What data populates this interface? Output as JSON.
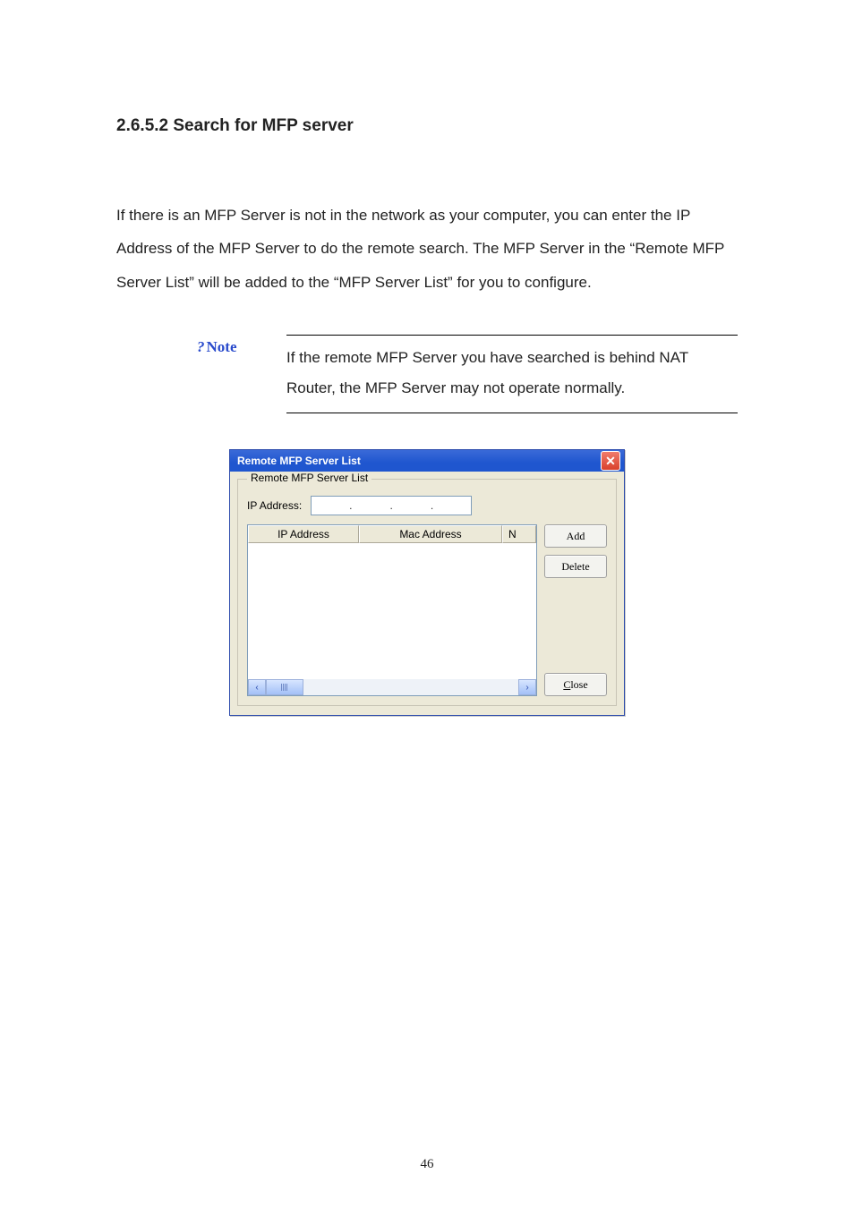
{
  "heading": "2.6.5.2 Search for MFP server",
  "paragraph": "If there is an MFP Server is not in the network as your computer, you can enter the IP Address of the MFP Server to do the remote search. The MFP Server in the “Remote MFP Server List” will be added to the “MFP Server List” for you to configure.",
  "note": {
    "label": "Note",
    "body": "If the remote MFP Server you have searched is behind NAT Router, the MFP Server may not operate normally."
  },
  "dialog": {
    "title": "Remote MFP Server List",
    "groupbox_label": "Remote MFP Server List",
    "ip_label": "IP Address:",
    "ip_dots": [
      ".",
      ".",
      "."
    ],
    "columns": {
      "ip": "IP Address",
      "mac": "Mac Address",
      "n": "N"
    },
    "buttons": {
      "add": "Add",
      "delete": "Delete",
      "close_prefix": "C",
      "close_rest": "lose"
    }
  },
  "page_number": "46"
}
